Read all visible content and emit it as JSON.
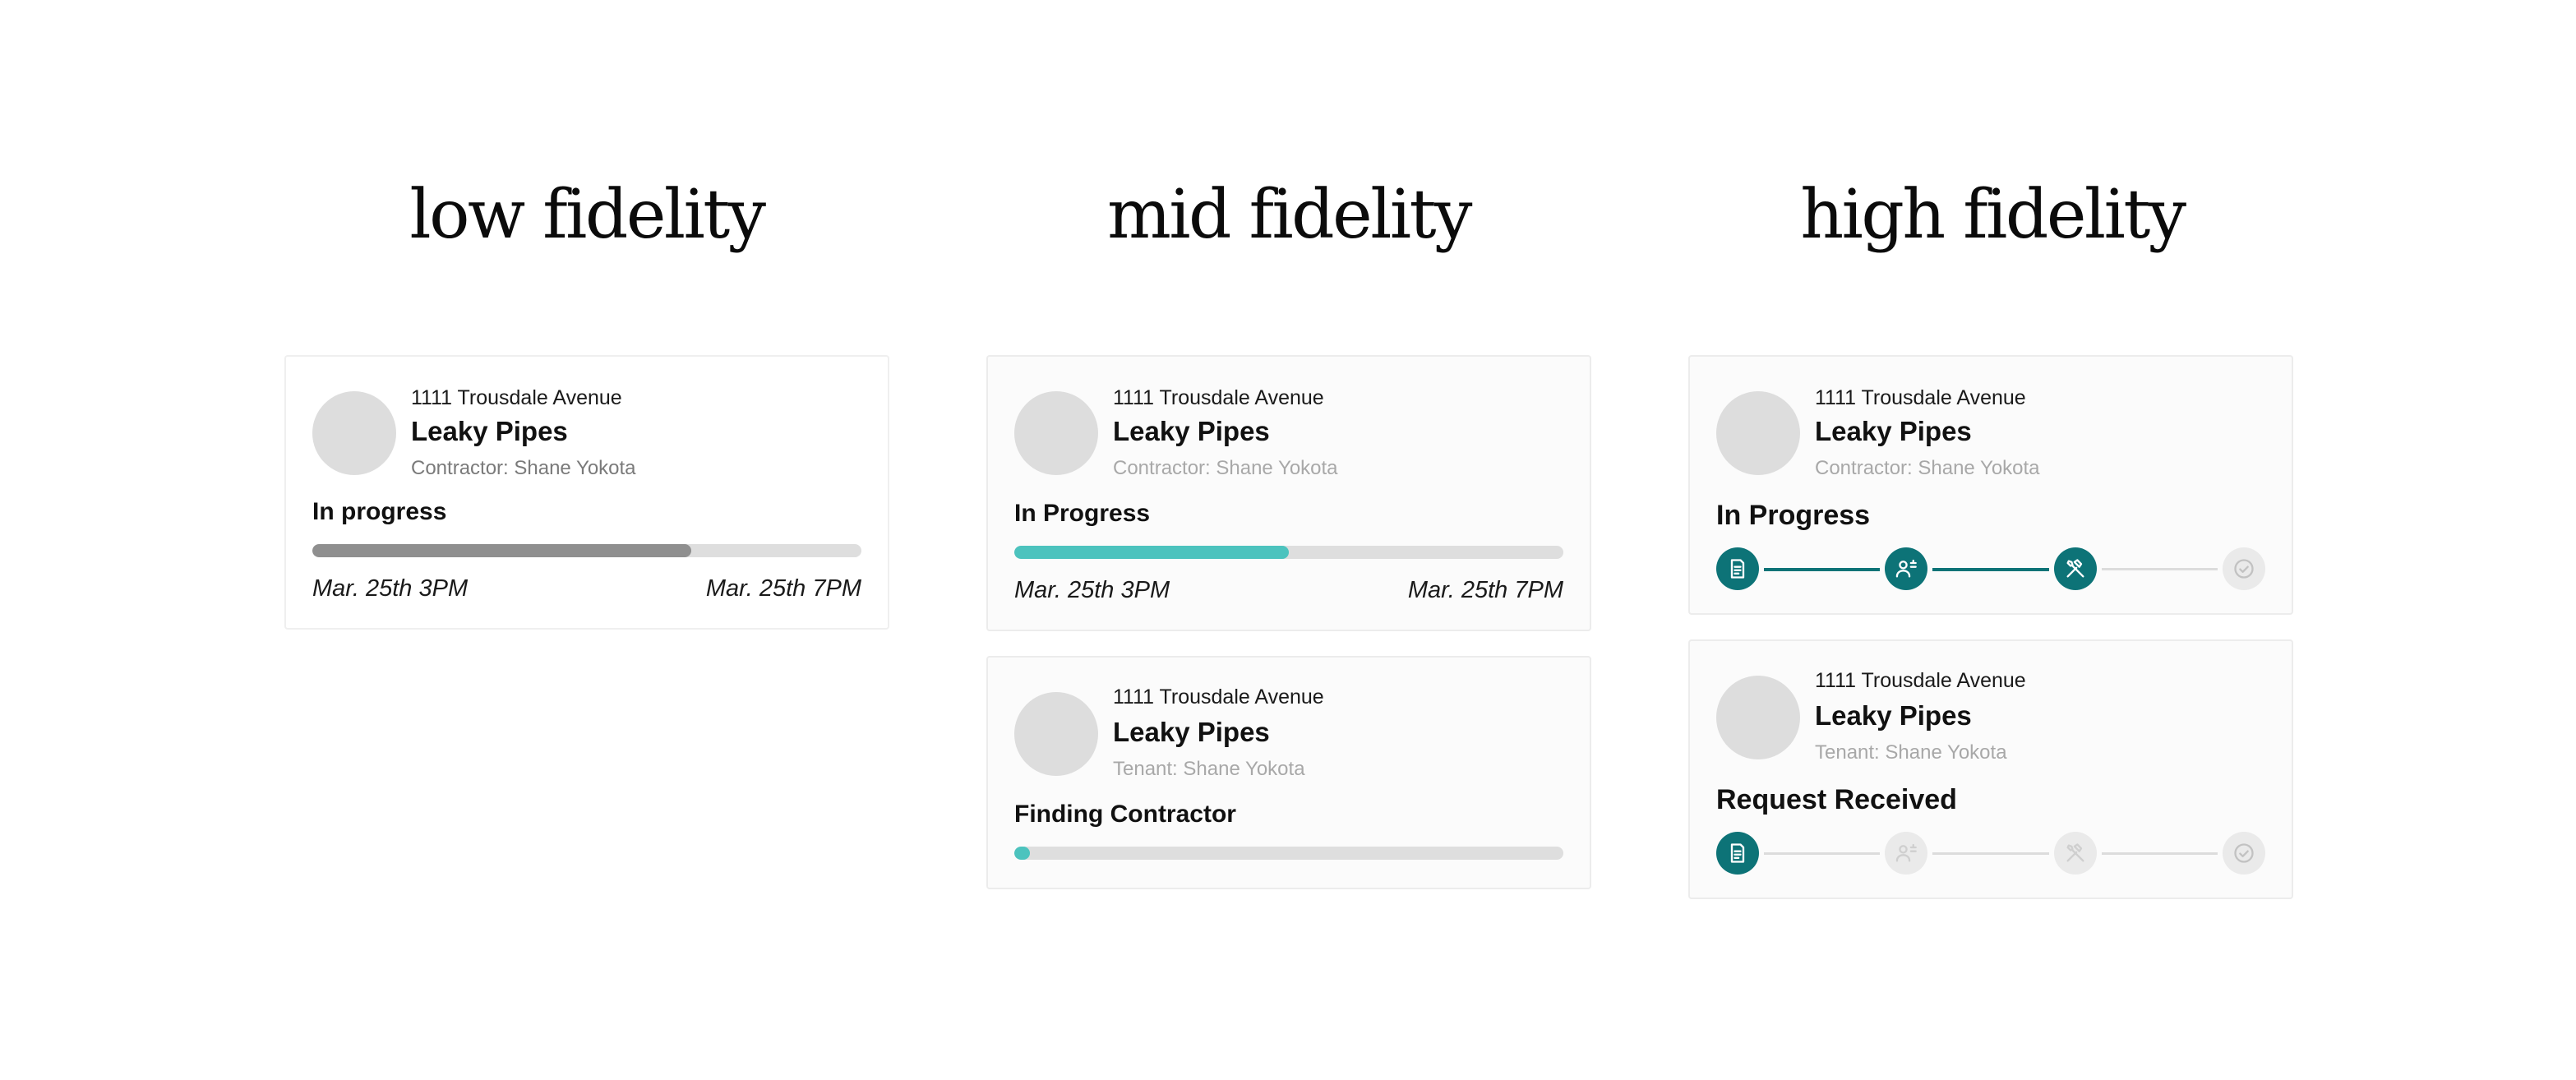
{
  "columns": [
    {
      "title": "low fidelity"
    },
    {
      "title": "mid fidelity"
    },
    {
      "title": "high fidelity"
    }
  ],
  "low": {
    "card1": {
      "address": "1111 Trousdale Avenue",
      "issue": "Leaky Pipes",
      "person": "Contractor: Shane Yokota",
      "status": "In progress",
      "progress": 0.69,
      "start": "Mar. 25th 3PM",
      "end": "Mar. 25th 7PM"
    }
  },
  "mid": {
    "card1": {
      "address": "1111 Trousdale Avenue",
      "issue": "Leaky Pipes",
      "person": "Contractor: Shane Yokota",
      "status": "In Progress",
      "progress": 0.5,
      "start": "Mar. 25th 3PM",
      "end": "Mar. 25th 7PM"
    },
    "card2": {
      "address": "1111 Trousdale Avenue",
      "issue": "Leaky Pipes",
      "person": "Tenant: Shane Yokota",
      "status": "Finding Contractor",
      "progress": 0.02
    }
  },
  "high": {
    "card1": {
      "address": "1111 Trousdale Avenue",
      "issue": "Leaky Pipes",
      "person": "Contractor: Shane Yokota",
      "status": "In Progress",
      "steps_completed": 3
    },
    "card2": {
      "address": "1111 Trousdale Avenue",
      "issue": "Leaky Pipes",
      "person": "Tenant: Shane Yokota",
      "status": "Request Received",
      "steps_completed": 1
    },
    "steps": [
      "document-icon",
      "assign-person-icon",
      "tools-icon",
      "check-circle-icon"
    ]
  },
  "colors": {
    "low_progress": "#8f8f8f",
    "mid_progress": "#4cc3be",
    "high_accent": "#0d7377",
    "inactive": "#dedede"
  }
}
